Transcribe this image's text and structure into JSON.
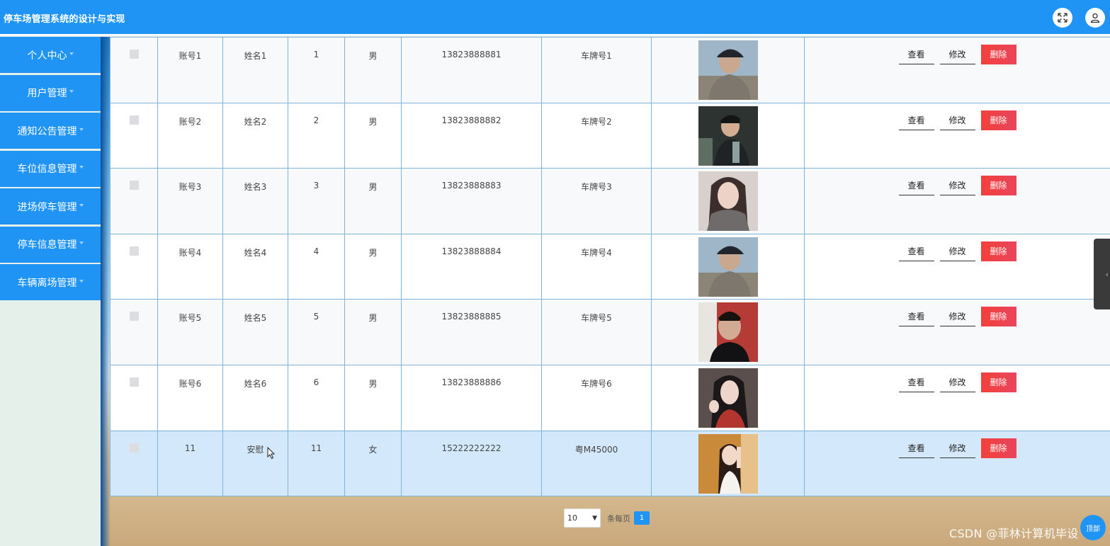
{
  "header": {
    "title": "停车场管理系统的设计与实现",
    "fullscreen_icon": "expand-icon",
    "user_icon": "user-icon"
  },
  "sidebar": {
    "items": [
      {
        "label": "个人中心"
      },
      {
        "label": "用户管理"
      },
      {
        "label": "通知公告管理"
      },
      {
        "label": "车位信息管理"
      },
      {
        "label": "进场停车管理"
      },
      {
        "label": "停车信息管理"
      },
      {
        "label": "车辆离场管理"
      }
    ]
  },
  "table": {
    "rows": [
      {
        "account": "账号1",
        "name": "姓名1",
        "no": "1",
        "gender": "男",
        "phone": "13823888881",
        "plate": "车牌号1",
        "photo": "man-cap"
      },
      {
        "account": "账号2",
        "name": "姓名2",
        "no": "2",
        "gender": "男",
        "phone": "13823888882",
        "plate": "车牌号2",
        "photo": "man-dark"
      },
      {
        "account": "账号3",
        "name": "姓名3",
        "no": "3",
        "gender": "男",
        "phone": "13823888883",
        "plate": "车牌号3",
        "photo": "woman-scarf"
      },
      {
        "account": "账号4",
        "name": "姓名4",
        "no": "4",
        "gender": "男",
        "phone": "13823888884",
        "plate": "车牌号4",
        "photo": "man-cap"
      },
      {
        "account": "账号5",
        "name": "姓名5",
        "no": "5",
        "gender": "男",
        "phone": "13823888885",
        "plate": "车牌号5",
        "photo": "man-red"
      },
      {
        "account": "账号6",
        "name": "姓名6",
        "no": "6",
        "gender": "男",
        "phone": "13823888886",
        "plate": "车牌号6",
        "photo": "woman-dark"
      },
      {
        "account": "11",
        "name": "安慰",
        "no": "11",
        "gender": "女",
        "phone": "15222222222",
        "plate": "粤M45000",
        "photo": "woman-light"
      }
    ],
    "actions": {
      "view": "查看",
      "edit": "修改",
      "delete": "删除"
    }
  },
  "pager": {
    "page_size": "10",
    "per_page_label": "条每页",
    "current_page": "1"
  },
  "watermark": "CSDN @菲林计算机毕设",
  "top_button": "顶部"
}
